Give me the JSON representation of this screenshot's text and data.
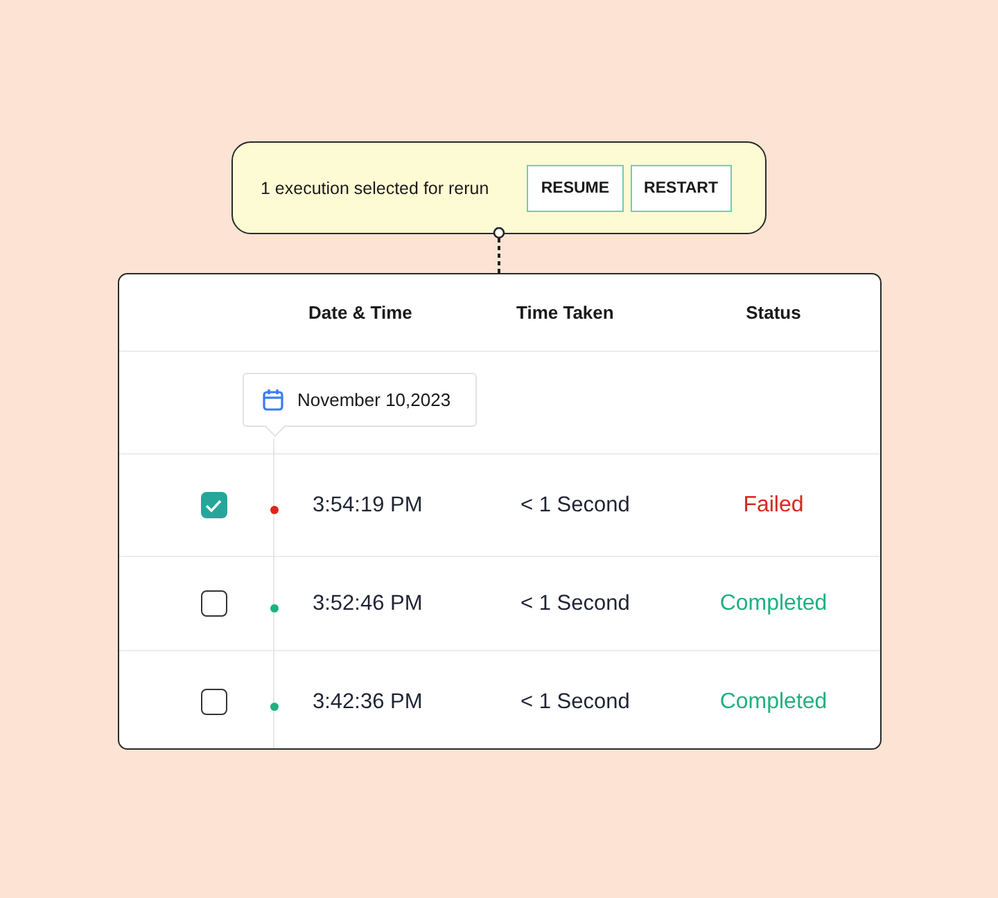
{
  "banner": {
    "message": "1 execution selected for rerun",
    "buttons": [
      "RESUME",
      "RESTART"
    ]
  },
  "table": {
    "columns": [
      "Date & Time",
      "Time Taken",
      "Status"
    ],
    "date": "November 10,2023",
    "rows": [
      {
        "checked": true,
        "time": "3:54:19 PM",
        "taken": "< 1 Second",
        "status": "Failed",
        "color": "#d9261f"
      },
      {
        "checked": false,
        "time": "3:52:46 PM",
        "taken": "< 1 Second",
        "status": "Completed",
        "color": "#1fb080"
      },
      {
        "checked": false,
        "time": "3:42:36 PM",
        "taken": "< 1 Second",
        "status": "Completed",
        "color": "#1fb080"
      }
    ]
  }
}
